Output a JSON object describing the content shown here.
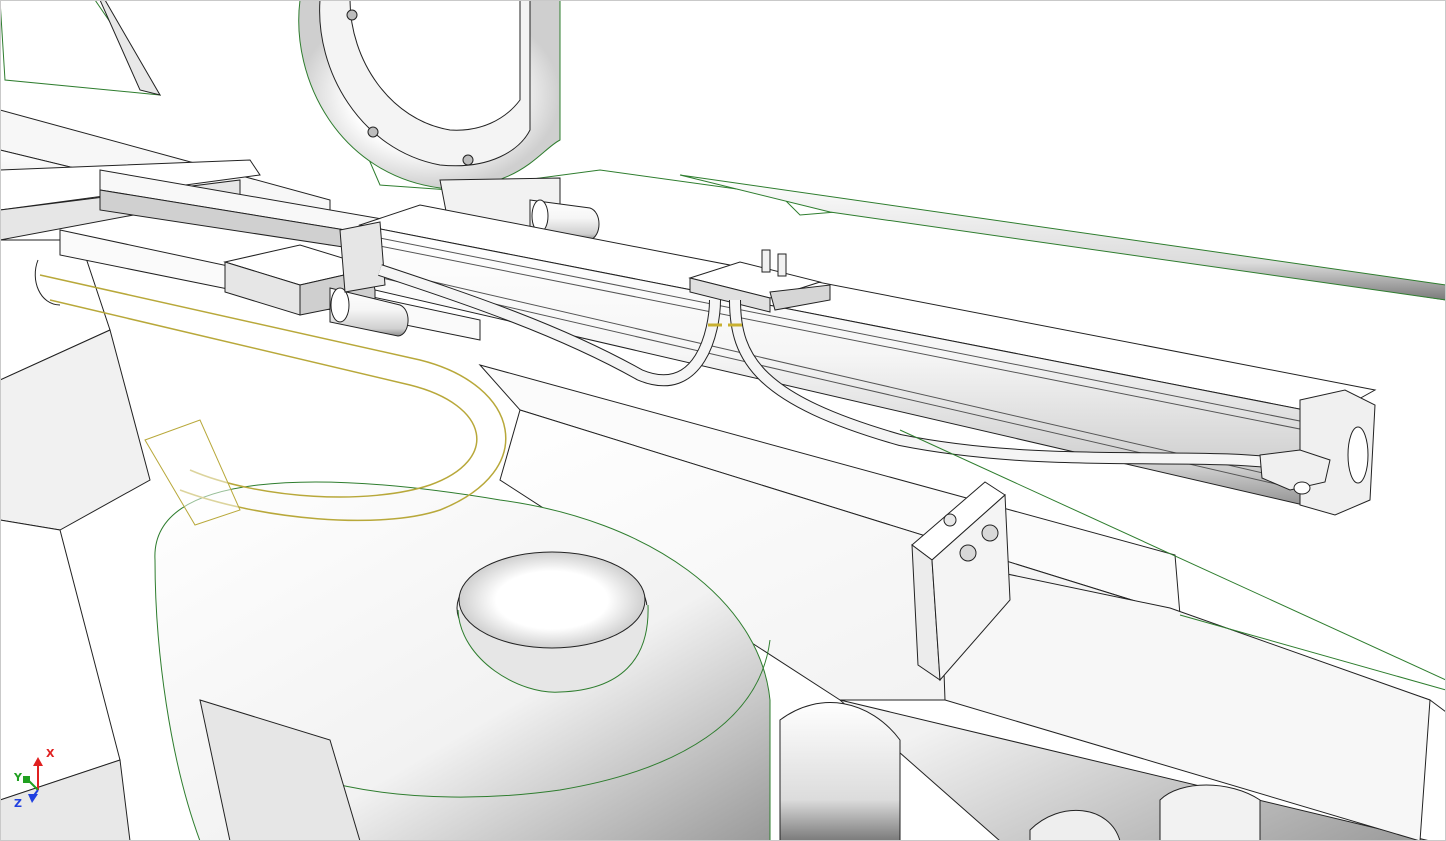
{
  "viewport": {
    "background": "#ffffff",
    "edge_color": "#2e7d2e",
    "highlight_color": "#b8a83a",
    "line_color": "#1a1a1a"
  },
  "triad": {
    "x_label": "X",
    "y_label": "Y",
    "z_label": "Z",
    "x_color": "#e02020",
    "y_color": "#20a020",
    "z_color": "#2040e0"
  }
}
